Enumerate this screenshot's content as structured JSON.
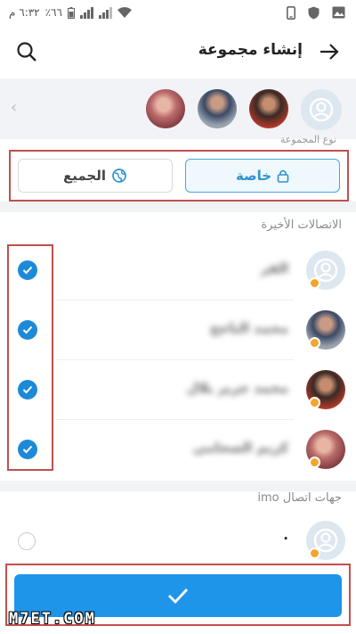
{
  "status_bar": {
    "time": "٦:٣٢ م",
    "battery": "٪٦٦"
  },
  "header": {
    "title": "إنشاء مجموعة",
    "back_icon": "arrow-right-icon",
    "search_icon": "search-icon"
  },
  "group_type": {
    "label": "نوع المجموعة",
    "private_label": "خاصة",
    "all_label": "الجميع"
  },
  "recent": {
    "label": "الاتصالات الأخيرة",
    "contacts": [
      {
        "name": "الفر",
        "checked": true
      },
      {
        "name": "محمد الناجح",
        "checked": true
      },
      {
        "name": "محمد جرير بلال",
        "checked": true
      },
      {
        "name": "كريم الصحامي",
        "checked": true
      }
    ]
  },
  "imo_contacts": {
    "label": "جهات اتصال imo",
    "contacts": [
      {
        "name": ".",
        "checked": false
      }
    ]
  },
  "confirm_icon": "checkmark-icon",
  "watermark": "M7ET.COM",
  "colors": {
    "accent": "#1f95ea",
    "highlight": "#c0504d",
    "badge": "#f4a52a"
  }
}
